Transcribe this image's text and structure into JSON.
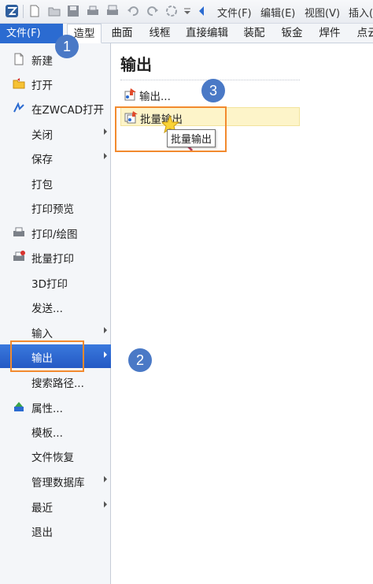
{
  "quick_access": {
    "menus": [
      "文件(F)",
      "编辑(E)",
      "视图(V)",
      "插入("
    ]
  },
  "ribbon": {
    "file_tab": "文件(F)",
    "tabs": [
      "造型",
      "曲面",
      "线框",
      "直接编辑",
      "装配",
      "钣金",
      "焊件",
      "点云"
    ],
    "active_tab": "造型"
  },
  "file_menu": {
    "items": [
      {
        "label": "新建",
        "icon": "new-file-icon",
        "submenu": false
      },
      {
        "label": "打开",
        "icon": "open-folder-icon",
        "submenu": false
      },
      {
        "label": "在ZWCAD打开",
        "icon": "zwcad-icon",
        "submenu": false
      },
      {
        "label": "关闭",
        "icon": "",
        "submenu": true
      },
      {
        "label": "保存",
        "icon": "",
        "submenu": true
      },
      {
        "label": "打包",
        "icon": "",
        "submenu": false
      },
      {
        "label": "打印预览",
        "icon": "",
        "submenu": false
      },
      {
        "label": "打印/绘图",
        "icon": "printer-icon",
        "submenu": false
      },
      {
        "label": "批量打印",
        "icon": "batch-print-icon",
        "submenu": false
      },
      {
        "label": "3D打印",
        "icon": "",
        "submenu": false
      },
      {
        "label": "发送...",
        "icon": "",
        "submenu": false
      },
      {
        "label": "输入",
        "icon": "",
        "submenu": true
      },
      {
        "label": "输出",
        "icon": "",
        "submenu": true,
        "selected": true
      },
      {
        "label": "搜索路径...",
        "icon": "",
        "submenu": false
      },
      {
        "label": "属性...",
        "icon": "properties-icon",
        "submenu": false
      },
      {
        "label": "模板...",
        "icon": "",
        "submenu": false
      },
      {
        "label": "文件恢复",
        "icon": "",
        "submenu": false
      },
      {
        "label": "管理数据库",
        "icon": "",
        "submenu": true
      },
      {
        "label": "最近",
        "icon": "",
        "submenu": true
      },
      {
        "label": "退出",
        "icon": "",
        "submenu": false
      }
    ]
  },
  "export_panel": {
    "title": "输出",
    "items": [
      {
        "label": "输出...",
        "icon": "export-icon"
      },
      {
        "label": "批量输出",
        "icon": "batch-export-icon",
        "hover": true
      }
    ],
    "tooltip": "批量输出"
  },
  "annotations": {
    "badges": [
      "1",
      "2",
      "3"
    ],
    "highlight_color": "#f28a2e",
    "badge_color": "#4a79c6"
  },
  "colors": {
    "accent": "#2b6bd1",
    "hover_bg": "#fdf4c9"
  }
}
